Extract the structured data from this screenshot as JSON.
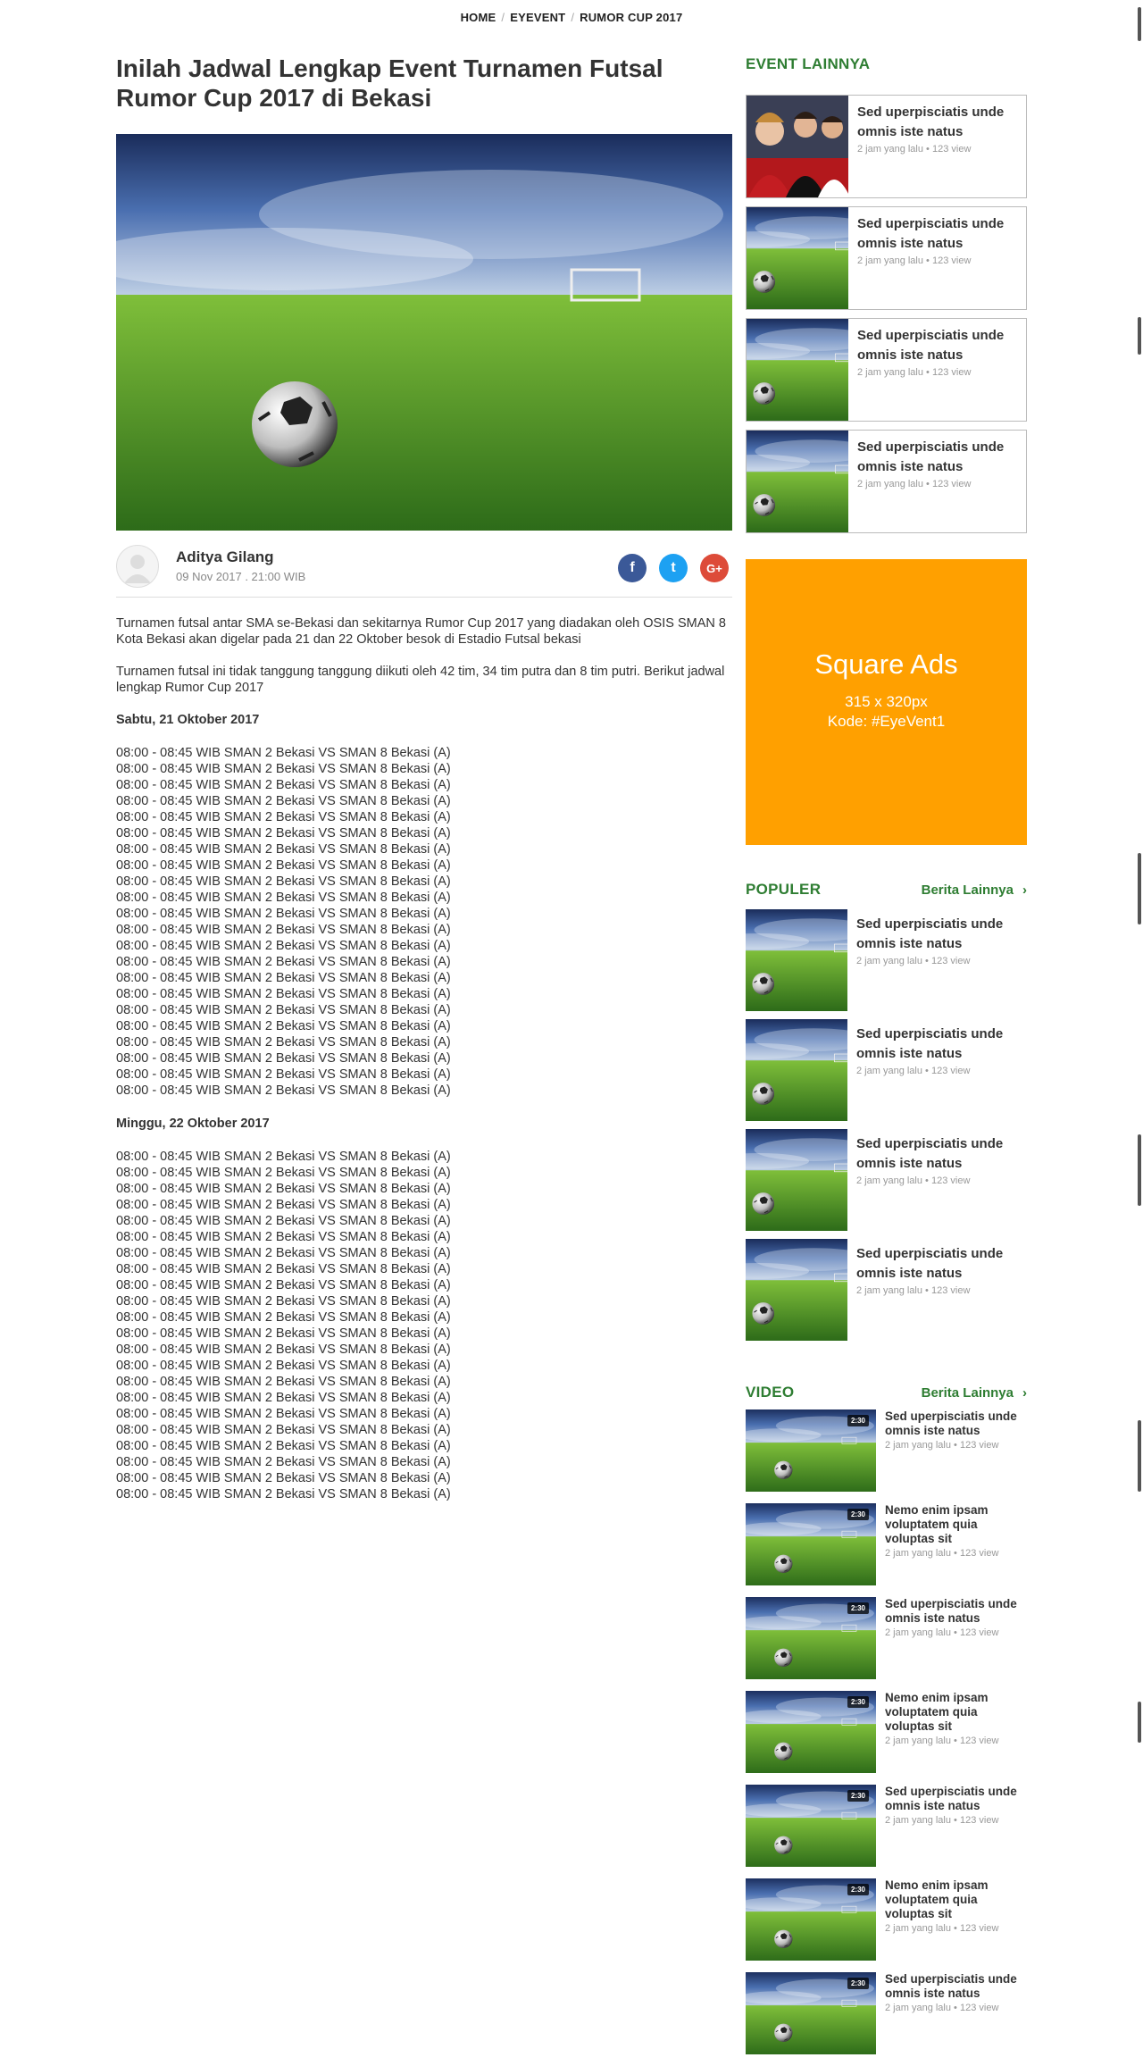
{
  "breadcrumb": {
    "home": "HOME",
    "section": "EYEVENT",
    "current": "RUMOR CUP 2017",
    "sep": "/"
  },
  "article": {
    "title": "Inilah Jadwal Lengkap Event Turnamen Futsal Rumor Cup 2017 di Bekasi",
    "author": "Aditya Gilang",
    "date": "09 Nov 2017 . 21:00 WIB",
    "share": {
      "facebook": "f",
      "twitter": "t",
      "googleplus": "G+"
    },
    "para1": "Turnamen futsal antar SMA se-Bekasi dan sekitarnya Rumor Cup 2017 yang diadakan oleh OSIS SMAN 8 Kota Bekasi akan digelar pada 21 dan 22 Oktober besok di Estadio Futsal bekasi",
    "para2": "Turnamen futsal ini tidak tanggung tanggung diikuti oleh 42 tim, 34 tim putra dan 8 tim putri. Berikut jadwal lengkap Rumor Cup 2017",
    "day1": "Sabtu, 21 Oktober 2017",
    "day1_matches": [
      "08:00 - 08:45 WIB SMAN 2 Bekasi VS SMAN 8 Bekasi (A)",
      "08:00 - 08:45 WIB SMAN 2 Bekasi VS SMAN 8 Bekasi (A)",
      "08:00 - 08:45 WIB SMAN 2 Bekasi VS SMAN 8 Bekasi (A)",
      "08:00 - 08:45 WIB SMAN 2 Bekasi VS SMAN 8 Bekasi (A)",
      "08:00 - 08:45 WIB SMAN 2 Bekasi VS SMAN 8 Bekasi (A)",
      "08:00 - 08:45 WIB SMAN 2 Bekasi VS SMAN 8 Bekasi (A)",
      "08:00 - 08:45 WIB SMAN 2 Bekasi VS SMAN 8 Bekasi (A)",
      "08:00 - 08:45 WIB SMAN 2 Bekasi VS SMAN 8 Bekasi (A)",
      "08:00 - 08:45 WIB SMAN 2 Bekasi VS SMAN 8 Bekasi (A)",
      "08:00 - 08:45 WIB SMAN 2 Bekasi VS SMAN 8 Bekasi (A)",
      "08:00 - 08:45 WIB SMAN 2 Bekasi VS SMAN 8 Bekasi (A)",
      "08:00 - 08:45 WIB SMAN 2 Bekasi VS SMAN 8 Bekasi (A)",
      "08:00 - 08:45 WIB SMAN 2 Bekasi VS SMAN 8 Bekasi (A)",
      "08:00 - 08:45 WIB SMAN 2 Bekasi VS SMAN 8 Bekasi (A)",
      "08:00 - 08:45 WIB SMAN 2 Bekasi VS SMAN 8 Bekasi (A)",
      "08:00 - 08:45 WIB SMAN 2 Bekasi VS SMAN 8 Bekasi (A)",
      "08:00 - 08:45 WIB SMAN 2 Bekasi VS SMAN 8 Bekasi (A)",
      "08:00 - 08:45 WIB SMAN 2 Bekasi VS SMAN 8 Bekasi (A)",
      "08:00 - 08:45 WIB SMAN 2 Bekasi VS SMAN 8 Bekasi (A)",
      "08:00 - 08:45 WIB SMAN 2 Bekasi VS SMAN 8 Bekasi (A)",
      "08:00 - 08:45 WIB SMAN 2 Bekasi VS SMAN 8 Bekasi (A)",
      "08:00 - 08:45 WIB SMAN 2 Bekasi VS SMAN 8 Bekasi (A)"
    ],
    "day2": "Minggu, 22 Oktober 2017",
    "day2_matches": [
      "08:00 - 08:45 WIB SMAN 2 Bekasi VS SMAN 8 Bekasi (A)",
      "08:00 - 08:45 WIB SMAN 2 Bekasi VS SMAN 8 Bekasi (A)",
      "08:00 - 08:45 WIB SMAN 2 Bekasi VS SMAN 8 Bekasi (A)",
      "08:00 - 08:45 WIB SMAN 2 Bekasi VS SMAN 8 Bekasi (A)",
      "08:00 - 08:45 WIB SMAN 2 Bekasi VS SMAN 8 Bekasi (A)",
      "08:00 - 08:45 WIB SMAN 2 Bekasi VS SMAN 8 Bekasi (A)",
      "08:00 - 08:45 WIB SMAN 2 Bekasi VS SMAN 8 Bekasi (A)",
      "08:00 - 08:45 WIB SMAN 2 Bekasi VS SMAN 8 Bekasi (A)",
      "08:00 - 08:45 WIB SMAN 2 Bekasi VS SMAN 8 Bekasi (A)",
      "08:00 - 08:45 WIB SMAN 2 Bekasi VS SMAN 8 Bekasi (A)",
      "08:00 - 08:45 WIB SMAN 2 Bekasi VS SMAN 8 Bekasi (A)",
      "08:00 - 08:45 WIB SMAN 2 Bekasi VS SMAN 8 Bekasi (A)",
      "08:00 - 08:45 WIB SMAN 2 Bekasi VS SMAN 8 Bekasi (A)",
      "08:00 - 08:45 WIB SMAN 2 Bekasi VS SMAN 8 Bekasi (A)",
      "08:00 - 08:45 WIB SMAN 2 Bekasi VS SMAN 8 Bekasi (A)",
      "08:00 - 08:45 WIB SMAN 2 Bekasi VS SMAN 8 Bekasi (A)",
      "08:00 - 08:45 WIB SMAN 2 Bekasi VS SMAN 8 Bekasi (A)",
      "08:00 - 08:45 WIB SMAN 2 Bekasi VS SMAN 8 Bekasi (A)",
      "08:00 - 08:45 WIB SMAN 2 Bekasi VS SMAN 8 Bekasi (A)",
      "08:00 - 08:45 WIB SMAN 2 Bekasi VS SMAN 8 Bekasi (A)",
      "08:00 - 08:45 WIB SMAN 2 Bekasi VS SMAN 8 Bekasi (A)",
      "08:00 - 08:45 WIB SMAN 2 Bekasi VS SMAN 8 Bekasi (A)"
    ]
  },
  "event_lainnya": {
    "title": "EVENT LAINNYA",
    "items": [
      {
        "title": "Sed uperpisciatis unde omnis iste natus",
        "time": "2 jam yang lalu",
        "views": "123 view",
        "thumb": "people-photo"
      },
      {
        "title": "Sed uperpisciatis unde omnis iste natus",
        "time": "2 jam yang lalu",
        "views": "123 view",
        "thumb": "football-field"
      },
      {
        "title": "Sed uperpisciatis unde omnis iste natus",
        "time": "2 jam yang lalu",
        "views": "123 view",
        "thumb": "football-field"
      },
      {
        "title": "Sed uperpisciatis unde omnis iste natus",
        "time": "2 jam yang lalu",
        "views": "123 view",
        "thumb": "football-field"
      }
    ]
  },
  "ads": {
    "title": "Square Ads",
    "size": "315 x 320px",
    "code": "Kode: #EyeVent1",
    "color": "#ffa000"
  },
  "populer": {
    "title": "POPULER",
    "more": "Berita Lainnya",
    "items": [
      {
        "title": "Sed uperpisciatis unde omnis iste natus",
        "time": "2 jam yang lalu",
        "views": "123 view"
      },
      {
        "title": "Sed uperpisciatis unde omnis iste natus",
        "time": "2 jam yang lalu",
        "views": "123 view"
      },
      {
        "title": "Sed uperpisciatis unde omnis iste natus",
        "time": "2 jam yang lalu",
        "views": "123 view"
      },
      {
        "title": "Sed uperpisciatis unde omnis iste natus",
        "time": "2 jam yang lalu",
        "views": "123 view"
      }
    ]
  },
  "video": {
    "title": "VIDEO",
    "more": "Berita Lainnya",
    "items": [
      {
        "title": "Sed uperpisciatis unde omnis iste natus",
        "time": "2 jam yang lalu",
        "views": "123 view",
        "duration": "2:30"
      },
      {
        "title": "Nemo enim ipsam voluptatem quia voluptas sit",
        "time": "2 jam yang lalu",
        "views": "123 view",
        "duration": "2:30"
      },
      {
        "title": "Sed uperpisciatis unde omnis iste natus",
        "time": "2 jam yang lalu",
        "views": "123 view",
        "duration": "2:30"
      },
      {
        "title": "Nemo enim ipsam voluptatem quia voluptas sit",
        "time": "2 jam yang lalu",
        "views": "123 view",
        "duration": "2:30"
      },
      {
        "title": "Sed uperpisciatis unde omnis iste natus",
        "time": "2 jam yang lalu",
        "views": "123 view",
        "duration": "2:30"
      },
      {
        "title": "Nemo enim ipsam voluptatem quia voluptas sit",
        "time": "2 jam yang lalu",
        "views": "123 view",
        "duration": "2:30"
      },
      {
        "title": "Sed uperpisciatis unde omnis iste natus",
        "time": "2 jam yang lalu",
        "views": "123 view",
        "duration": "2:30"
      }
    ]
  },
  "colors": {
    "accent": "#2e7d32",
    "ads": "#ffa000",
    "facebook": "#3b5998",
    "twitter": "#1da1f2",
    "googleplus": "#dd4b39"
  }
}
